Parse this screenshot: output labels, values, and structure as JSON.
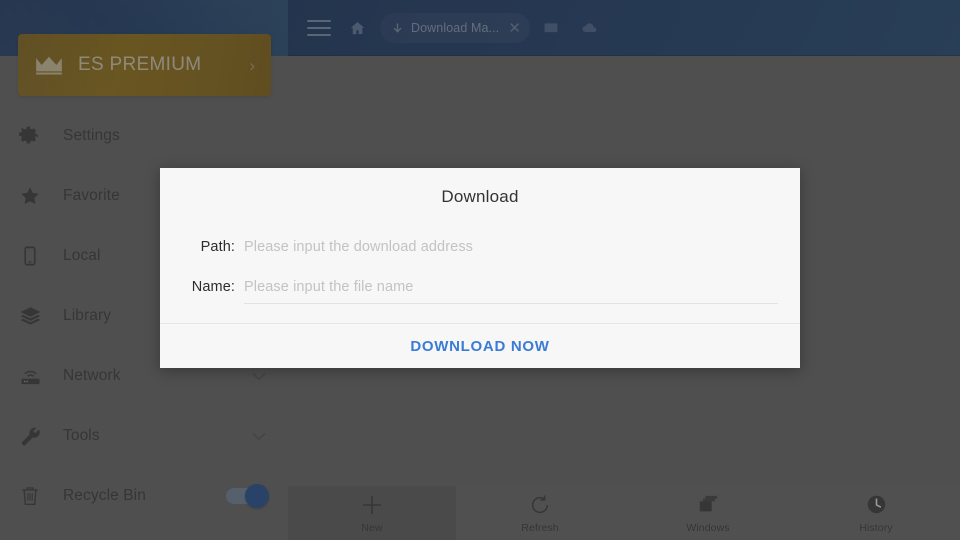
{
  "topbar": {
    "menu_icon": "hamburger-menu-icon",
    "home_icon": "home-icon",
    "tab": {
      "download_icon": "download-arrow-icon",
      "title": "Download Ma...",
      "close_icon": "close-x-icon"
    },
    "bookmark_icon": "bookmark-grid-icon",
    "cloud_icon": "cloud-icon",
    "background_color": "#123566"
  },
  "sidebar": {
    "premium": {
      "label": "ES PREMIUM",
      "crown_icon": "crown-icon",
      "chevron": "›",
      "background_color": "#8a670a"
    },
    "items": [
      {
        "label": "Settings",
        "icon": "gear-icon",
        "accessory": "none"
      },
      {
        "label": "Favorite",
        "icon": "star-icon",
        "accessory": "none"
      },
      {
        "label": "Local",
        "icon": "phone-icon",
        "accessory": "none"
      },
      {
        "label": "Library",
        "icon": "layers-icon",
        "accessory": "none"
      },
      {
        "label": "Network",
        "icon": "router-wifi-icon",
        "accessory": "chevron"
      },
      {
        "label": "Tools",
        "icon": "wrench-icon",
        "accessory": "chevron"
      },
      {
        "label": "Recycle Bin",
        "icon": "trash-icon",
        "accessory": "toggle",
        "toggle_on": true
      }
    ],
    "toggle_color": "#17478f",
    "background_color": "#606060"
  },
  "dialog": {
    "title": "Download",
    "path": {
      "label": "Path:",
      "value": "",
      "placeholder": "Please input the download address"
    },
    "name": {
      "label": "Name:",
      "value": "",
      "placeholder": "Please input the file name"
    },
    "action_label": "DOWNLOAD NOW",
    "action_color": "#3a7bd5",
    "highlight_color": "#f23a12",
    "background_color": "#f7f7f7"
  },
  "bottombar": {
    "items": [
      {
        "label": "New",
        "icon": "plus-icon",
        "active": true
      },
      {
        "label": "Refresh",
        "icon": "refresh-circle-icon",
        "active": false
      },
      {
        "label": "Windows",
        "icon": "stacked-windows-icon",
        "active": false
      },
      {
        "label": "History",
        "icon": "clock-icon",
        "active": false
      }
    ]
  }
}
